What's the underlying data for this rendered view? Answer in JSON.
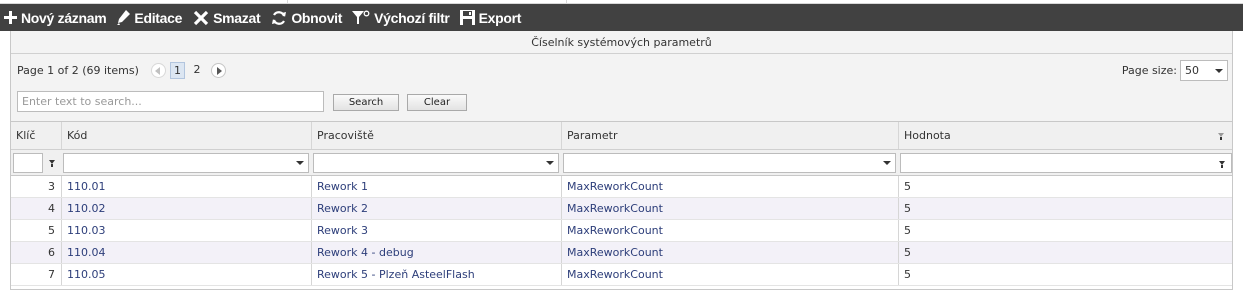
{
  "toolbar": {
    "new_label": "Nový záznam",
    "edit_label": "Editace",
    "delete_label": "Smazat",
    "refresh_label": "Obnovit",
    "default_filter_label": "Výchozí filtr",
    "export_label": "Export"
  },
  "grid": {
    "title": "Číselník systémových parametrů"
  },
  "pager": {
    "info": "Page 1 of 2 (69 items)",
    "pages": [
      "1",
      "2"
    ],
    "current_page": "1",
    "page_size_label": "Page size:",
    "page_size": "50"
  },
  "search": {
    "placeholder": "Enter text to search...",
    "search_label": "Search",
    "clear_label": "Clear"
  },
  "columns": {
    "key": "Klíč",
    "code": "Kód",
    "workplace": "Pracoviště",
    "parameter": "Parametr",
    "value": "Hodnota"
  },
  "rows": [
    {
      "key": "3",
      "code": "110.01",
      "workplace": "Rework 1",
      "parameter": "MaxReworkCount",
      "value": "5"
    },
    {
      "key": "4",
      "code": "110.02",
      "workplace": "Rework 2",
      "parameter": "MaxReworkCount",
      "value": "5"
    },
    {
      "key": "5",
      "code": "110.03",
      "workplace": "Rework 3",
      "parameter": "MaxReworkCount",
      "value": "5"
    },
    {
      "key": "6",
      "code": "110.04",
      "workplace": "Rework 4 - debug",
      "parameter": "MaxReworkCount",
      "value": "5"
    },
    {
      "key": "7",
      "code": "110.05",
      "workplace": "Rework 5 - Plzeň AsteelFlash",
      "parameter": "MaxReworkCount",
      "value": "5"
    }
  ],
  "colors": {
    "toolbar_bg": "#414141",
    "link_text": "#2d3e7a",
    "alt_row": "#f3f1f8"
  },
  "icons": {
    "new": "plus-icon",
    "edit": "pencil-icon",
    "delete": "cross-icon",
    "refresh": "refresh-icon",
    "default_filter": "filter-icon",
    "export": "save-icon"
  }
}
